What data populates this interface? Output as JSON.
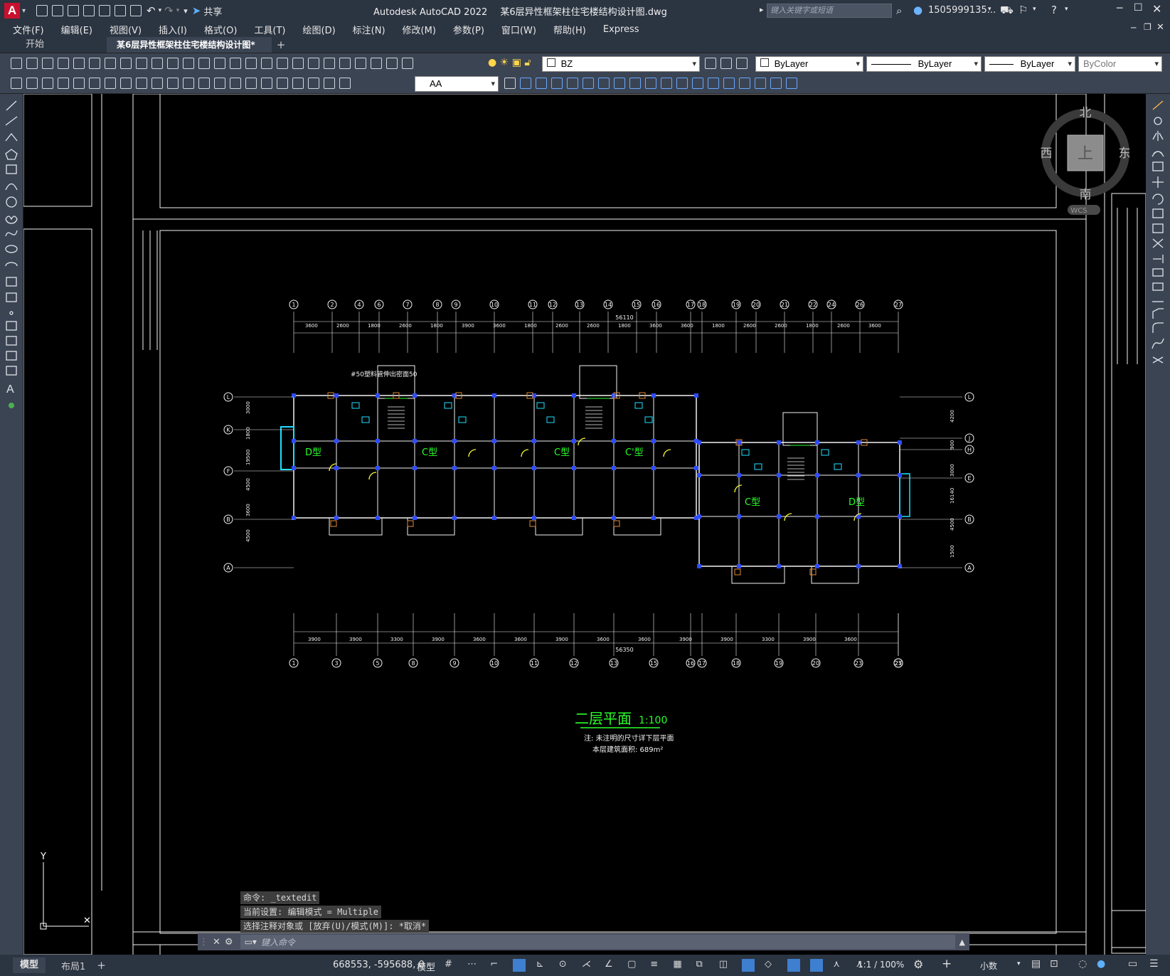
{
  "app": {
    "product": "Autodesk AutoCAD 2022",
    "filename": "某6层异性框架柱住宅楼结构设计图.dwg",
    "share_label": "共享",
    "search_placeholder": "键入关键字或短语",
    "user": "1505999135...",
    "accent": "#c8102e"
  },
  "menu": [
    "文件(F)",
    "编辑(E)",
    "视图(V)",
    "插入(I)",
    "格式(O)",
    "工具(T)",
    "绘图(D)",
    "标注(N)",
    "修改(M)",
    "参数(P)",
    "窗口(W)",
    "帮助(H)",
    "Express"
  ],
  "tabs": [
    {
      "label": "开始",
      "active": false
    },
    {
      "label": "某6层异性框架柱住宅楼结构设计图*",
      "active": true
    }
  ],
  "toolbar": {
    "layer": "BZ",
    "color": "ByLayer",
    "linetype": "ByLayer",
    "lineweight": "ByLayer",
    "plotstyle": "ByColor",
    "textstyle": "AA"
  },
  "viewcube": {
    "north": "北",
    "south": "南",
    "east": "东",
    "west": "西",
    "face": "上",
    "wcs": "WCS"
  },
  "drawing": {
    "title": "二层平面",
    "scale": "1:100",
    "note1": "注: 未注明的尺寸详下层平面",
    "note2": "本层建筑面积: 689m²",
    "overall_top": "56110",
    "overall_bottom": "56350",
    "pipe_label": "#50塑料管伸出密面50",
    "types": [
      "D型",
      "C型",
      "C型",
      "C'型",
      "C型",
      "D型"
    ],
    "axis_top": [
      "1",
      "2",
      "4",
      "6",
      "7",
      "8",
      "9",
      "10",
      "11",
      "12",
      "13",
      "14",
      "15",
      "16",
      "17",
      "18",
      "19",
      "20",
      "21",
      "22",
      "24",
      "26",
      "27"
    ],
    "axis_bottom": [
      "1",
      "3",
      "5",
      "8",
      "9",
      "10",
      "11",
      "12",
      "13",
      "15",
      "16",
      "17",
      "18",
      "19",
      "20",
      "23",
      "25",
      "27"
    ],
    "axis_left": [
      "L",
      "K",
      "F",
      "B",
      "A"
    ],
    "axis_right": [
      "L",
      "J",
      "H",
      "E",
      "B",
      "A"
    ],
    "dims_top": [
      "3600",
      "2600",
      "1800",
      "2600",
      "1800",
      "3900",
      "3600",
      "1800",
      "2600",
      "2600",
      "1800",
      "3600",
      "3600",
      "1800",
      "2600",
      "2600",
      "1800",
      "2600",
      "3600"
    ],
    "dims_bottom": [
      "3900",
      "3900",
      "3300",
      "3900",
      "3600",
      "3600",
      "3900",
      "3600",
      "3600",
      "3900",
      "3900",
      "3300",
      "3900",
      "3600"
    ],
    "dims_left": [
      "3000",
      "1800",
      "19500",
      "4500",
      "3600",
      "4500"
    ],
    "dims_right": [
      "4200",
      "900",
      "3000",
      "16140",
      "4500",
      "1500"
    ]
  },
  "commandline": {
    "history": [
      "命令: _textedit",
      "当前设置: 编辑模式 = Multiple",
      "选择注释对象或 [放弃(U)/模式(M)]: *取消*"
    ],
    "placeholder": "键入命令"
  },
  "status": {
    "model_tab": "模型",
    "layout_tab": "布局1",
    "coords": "668553, -595688, 0",
    "model_space": "模型",
    "scale": "1:1 / 100%",
    "units": "小数"
  }
}
